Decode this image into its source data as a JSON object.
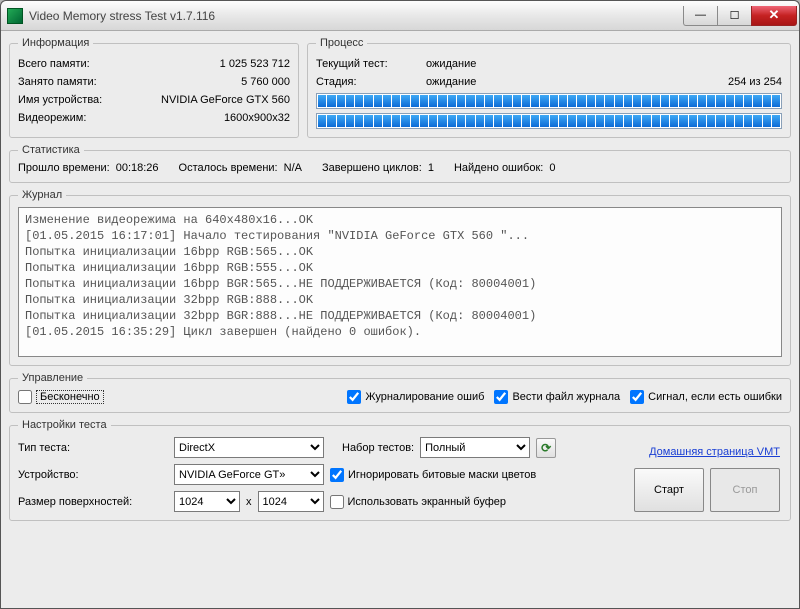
{
  "window": {
    "title": "Video Memory stress Test v1.7.116"
  },
  "info": {
    "legend": "Информация",
    "rows": [
      {
        "k": "Всего памяти:",
        "v": "1 025 523 712"
      },
      {
        "k": "Занято памяти:",
        "v": "5 760 000"
      },
      {
        "k": "Имя устройства:",
        "v": "NVIDIA GeForce GTX 560"
      },
      {
        "k": "Видеорежим:",
        "v": "1600x900x32"
      }
    ]
  },
  "process": {
    "legend": "Процесс",
    "current_label": "Текущий тест:",
    "current_value": "ожидание",
    "stage_label": "Стадия:",
    "stage_value": "ожидание",
    "stage_right": "254 из 254"
  },
  "stats": {
    "legend": "Статистика",
    "elapsed_label": "Прошло времени:",
    "elapsed_value": "00:18:26",
    "remaining_label": "Осталось времени:",
    "remaining_value": "N/A",
    "cycles_label": "Завершено циклов:",
    "cycles_value": "1",
    "errors_label": "Найдено ошибок:",
    "errors_value": "0"
  },
  "log": {
    "legend": "Журнал",
    "text": "Изменение видеорежима на 640x480x16...OK\n[01.05.2015 16:17:01] Начало тестирования \"NVIDIA GeForce GTX 560 \"...\nПопытка инициализации 16bpp RGB:565...OK\nПопытка инициализации 16bpp RGB:555...OK\nПопытка инициализации 16bpp BGR:565...НЕ ПОДДЕРЖИВАЕТСЯ (Код: 80004001)\nПопытка инициализации 32bpp RGB:888...OK\nПопытка инициализации 32bpp BGR:888...НЕ ПОДДЕРЖИВАЕТСЯ (Код: 80004001)\n[01.05.2015 16:35:29] Цикл завершен (найдено 0 ошибок)."
  },
  "control": {
    "legend": "Управление",
    "infinite": "Бесконечно",
    "log_errors": "Журналирование ошиб",
    "keep_log": "Вести файл журнала",
    "signal": "Сигнал, если есть ошибки"
  },
  "settings": {
    "legend": "Настройки теста",
    "test_type_label": "Тип теста:",
    "test_type_value": "DirectX",
    "test_set_label": "Набор тестов:",
    "test_set_value": "Полный",
    "home_link": "Домашняя страница VMT",
    "device_label": "Устройство:",
    "device_value": "NVIDIA GeForce GT»",
    "ignore_masks": "Игнорировать битовые маски цветов",
    "surface_label": "Размер поверхностей:",
    "surface_w": "1024",
    "surface_x": "x",
    "surface_h": "1024",
    "use_buffer": "Использовать экранный буфер",
    "start": "Старт",
    "stop": "Стоп"
  }
}
